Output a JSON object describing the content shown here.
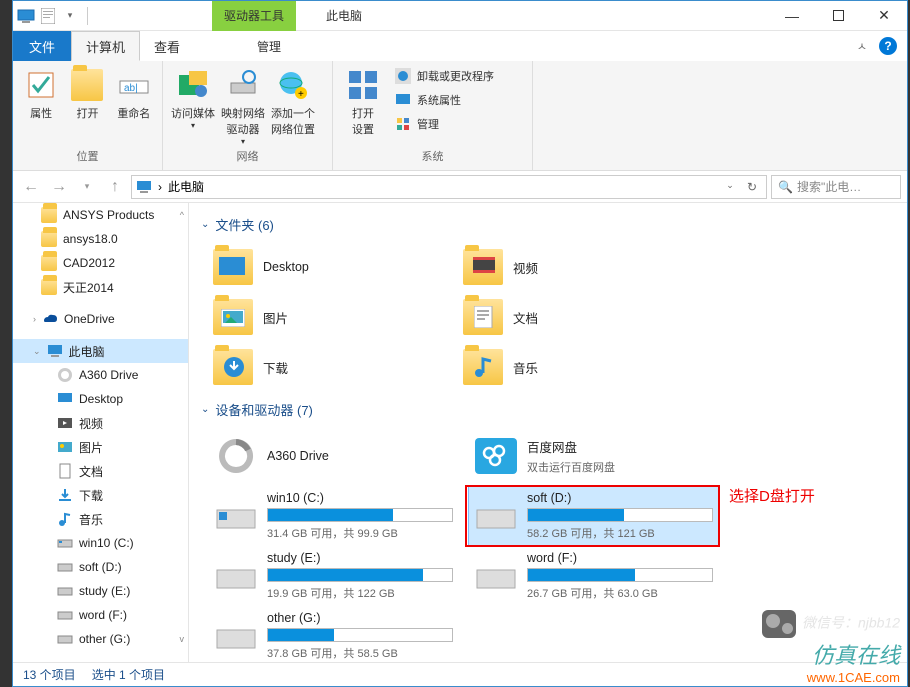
{
  "window": {
    "context_tab": "驱动器工具",
    "manage_tab": "管理",
    "title": "此电脑"
  },
  "tabs": {
    "file": "文件",
    "computer": "计算机",
    "view": "查看"
  },
  "ribbon": {
    "group_location": "位置",
    "group_network": "网络",
    "group_system": "系统",
    "properties": "属性",
    "open": "打开",
    "rename": "重命名",
    "access_media": "访问媒体",
    "map_drive": "映射网络\n驱动器",
    "add_location": "添加一个\n网络位置",
    "open_settings": "打开\n设置",
    "uninstall": "卸载或更改程序",
    "sys_props": "系统属性",
    "manage": "管理"
  },
  "address": {
    "path_sep": "›",
    "path": "此电脑",
    "search_placeholder": "搜索\"此电…"
  },
  "sidebar": {
    "items": [
      {
        "label": "ANSYS Products",
        "icon": "folder"
      },
      {
        "label": "ansys18.0",
        "icon": "folder"
      },
      {
        "label": "CAD2012",
        "icon": "folder"
      },
      {
        "label": "天正2014",
        "icon": "folder"
      }
    ],
    "onedrive": "OneDrive",
    "thispc": "此电脑",
    "pc_children": [
      {
        "label": "A360 Drive",
        "icon": "a360"
      },
      {
        "label": "Desktop",
        "icon": "desktop"
      },
      {
        "label": "视频",
        "icon": "video"
      },
      {
        "label": "图片",
        "icon": "pictures"
      },
      {
        "label": "文档",
        "icon": "docs"
      },
      {
        "label": "下载",
        "icon": "downloads"
      },
      {
        "label": "音乐",
        "icon": "music"
      },
      {
        "label": "win10 (C:)",
        "icon": "drive"
      },
      {
        "label": "soft (D:)",
        "icon": "drive"
      },
      {
        "label": "study (E:)",
        "icon": "drive"
      },
      {
        "label": "word (F:)",
        "icon": "drive"
      },
      {
        "label": "other (G:)",
        "icon": "drive"
      }
    ]
  },
  "content": {
    "section_folders": "文件夹 (6)",
    "folders": [
      {
        "label": "Desktop",
        "icon": "desktop"
      },
      {
        "label": "视频",
        "icon": "video"
      },
      {
        "label": "图片",
        "icon": "pictures"
      },
      {
        "label": "文档",
        "icon": "docs"
      },
      {
        "label": "下载",
        "icon": "downloads"
      },
      {
        "label": "音乐",
        "icon": "music"
      }
    ],
    "section_drives": "设备和驱动器 (7)",
    "a360": {
      "name": "A360 Drive"
    },
    "baidu": {
      "name": "百度网盘",
      "sub": "双击运行百度网盘"
    },
    "drives": [
      {
        "name": "win10 (C:)",
        "stat": "31.4 GB 可用，共 99.9 GB",
        "fill": 68
      },
      {
        "name": "soft (D:)",
        "stat": "58.2 GB 可用，共 121 GB",
        "fill": 52,
        "selected": true
      },
      {
        "name": "study (E:)",
        "stat": "19.9 GB 可用，共 122 GB",
        "fill": 84
      },
      {
        "name": "word (F:)",
        "stat": "26.7 GB 可用，共 63.0 GB",
        "fill": 58
      },
      {
        "name": "other (G:)",
        "stat": "37.8 GB 可用，共 58.5 GB",
        "fill": 36
      }
    ]
  },
  "annotation": "选择D盘打开",
  "status": {
    "count": "13 个项目",
    "sel": "选中 1 个项目"
  },
  "watermark": {
    "line1": "微信号：njbb12",
    "line2": "仿真在线",
    "line3": "www.1CAE.com"
  }
}
